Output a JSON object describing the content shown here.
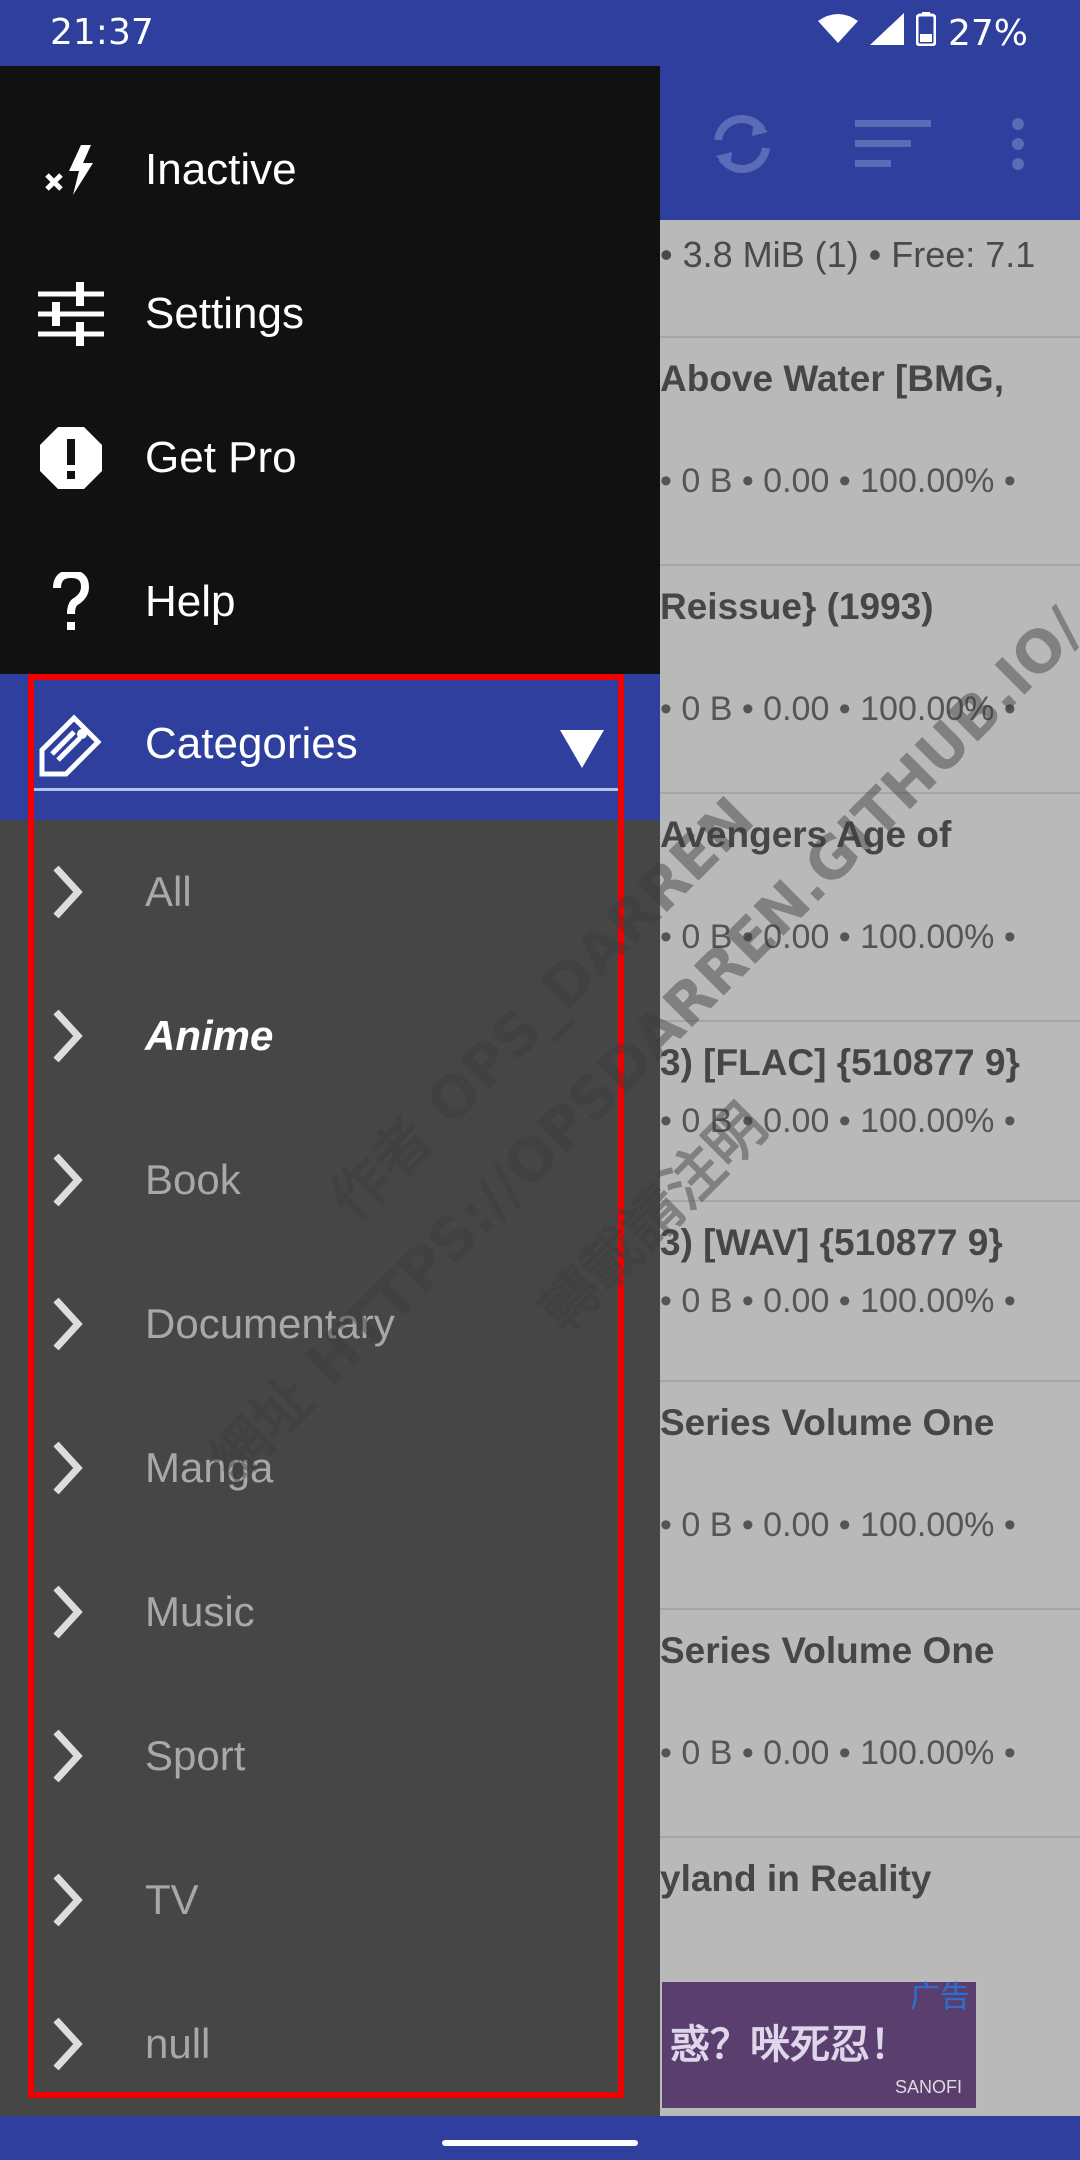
{
  "status_bar": {
    "time": "21:37",
    "battery": "27%"
  },
  "background": {
    "subtitle": "• 3.8 MiB (1) • Free: 7.1",
    "rows": [
      {
        "title": "Above Water [BMG,",
        "stats": "• 0 B • 0.00 • 100.00% •"
      },
      {
        "title": "Reissue} (1993)",
        "stats": "• 0 B • 0.00 • 100.00% •"
      },
      {
        "title": " Avengers Age of",
        "stats": "• 0 B • 0.00 • 100.00% •"
      },
      {
        "title": "3) [FLAC] {510877 9}",
        "stats": "• 0 B • 0.00 • 100.00% •"
      },
      {
        "title": "3) [WAV] {510877 9}",
        "stats": "• 0 B • 0.00 • 100.00% •"
      },
      {
        "title": "Series Volume One",
        "stats": "• 0 B • 0.00 • 100.00% •"
      },
      {
        "title": "Series Volume One",
        "stats": "• 0 B • 0.00 • 100.00% •"
      },
      {
        "title": "yland in Reality",
        "stats": ""
      }
    ],
    "ad": {
      "label": "广告",
      "text": "惑？咪死忍！",
      "brand": "SANOFI"
    }
  },
  "drawer": {
    "menu": [
      {
        "label": "Inactive",
        "icon": "inactive-icon"
      },
      {
        "label": "Settings",
        "icon": "sliders-icon"
      },
      {
        "label": "Get Pro",
        "icon": "alert-octagon-icon"
      },
      {
        "label": "Help",
        "icon": "question-icon"
      }
    ],
    "categories_header": "Categories",
    "categories": [
      "All",
      "Anime",
      "Book",
      "Documentary",
      "Manga",
      "Music",
      "Sport",
      "TV",
      "null"
    ],
    "active_category": "Anime"
  },
  "watermark": {
    "line1": "作者 OPS_DARREN",
    "line2": "網址 HTTPS://OPSDARREN.GITHUB.IO/",
    "line3": "轉載請注明"
  },
  "colors": {
    "primary": "#2e3f9e",
    "drawer_dark": "#111111",
    "drawer_gray": "#464646",
    "highlight": "#f00000"
  }
}
